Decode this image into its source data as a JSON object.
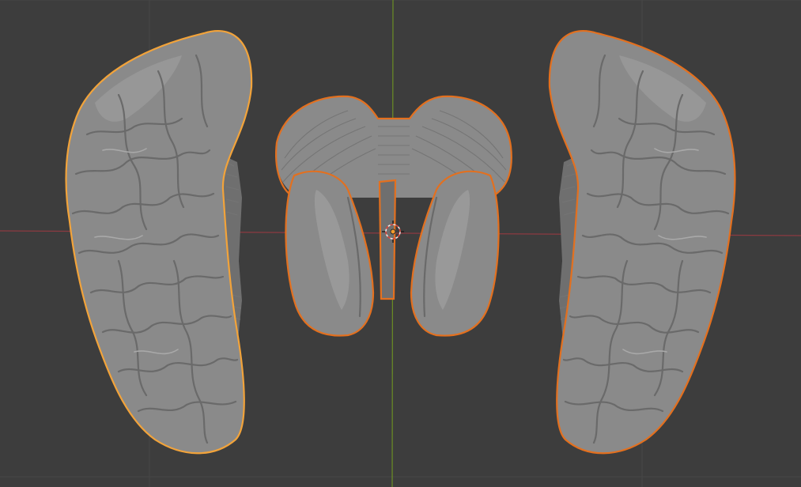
{
  "viewport": {
    "background_color": "#3d3d3d",
    "grid_color": "#474747",
    "x_axis_color": "#8c3a41",
    "y_axis_color": "#6b8e24",
    "selection_color": "#e3701f",
    "active_selection_color": "#f2a33a"
  },
  "objects": [
    {
      "name": "left-hemisphere",
      "selected": true,
      "active": true
    },
    {
      "name": "cerebellum-brainstem",
      "selected": true,
      "active": false
    },
    {
      "name": "right-hemisphere",
      "selected": true,
      "active": false
    }
  ],
  "cursor": {
    "icon": "3d-cursor-icon"
  }
}
